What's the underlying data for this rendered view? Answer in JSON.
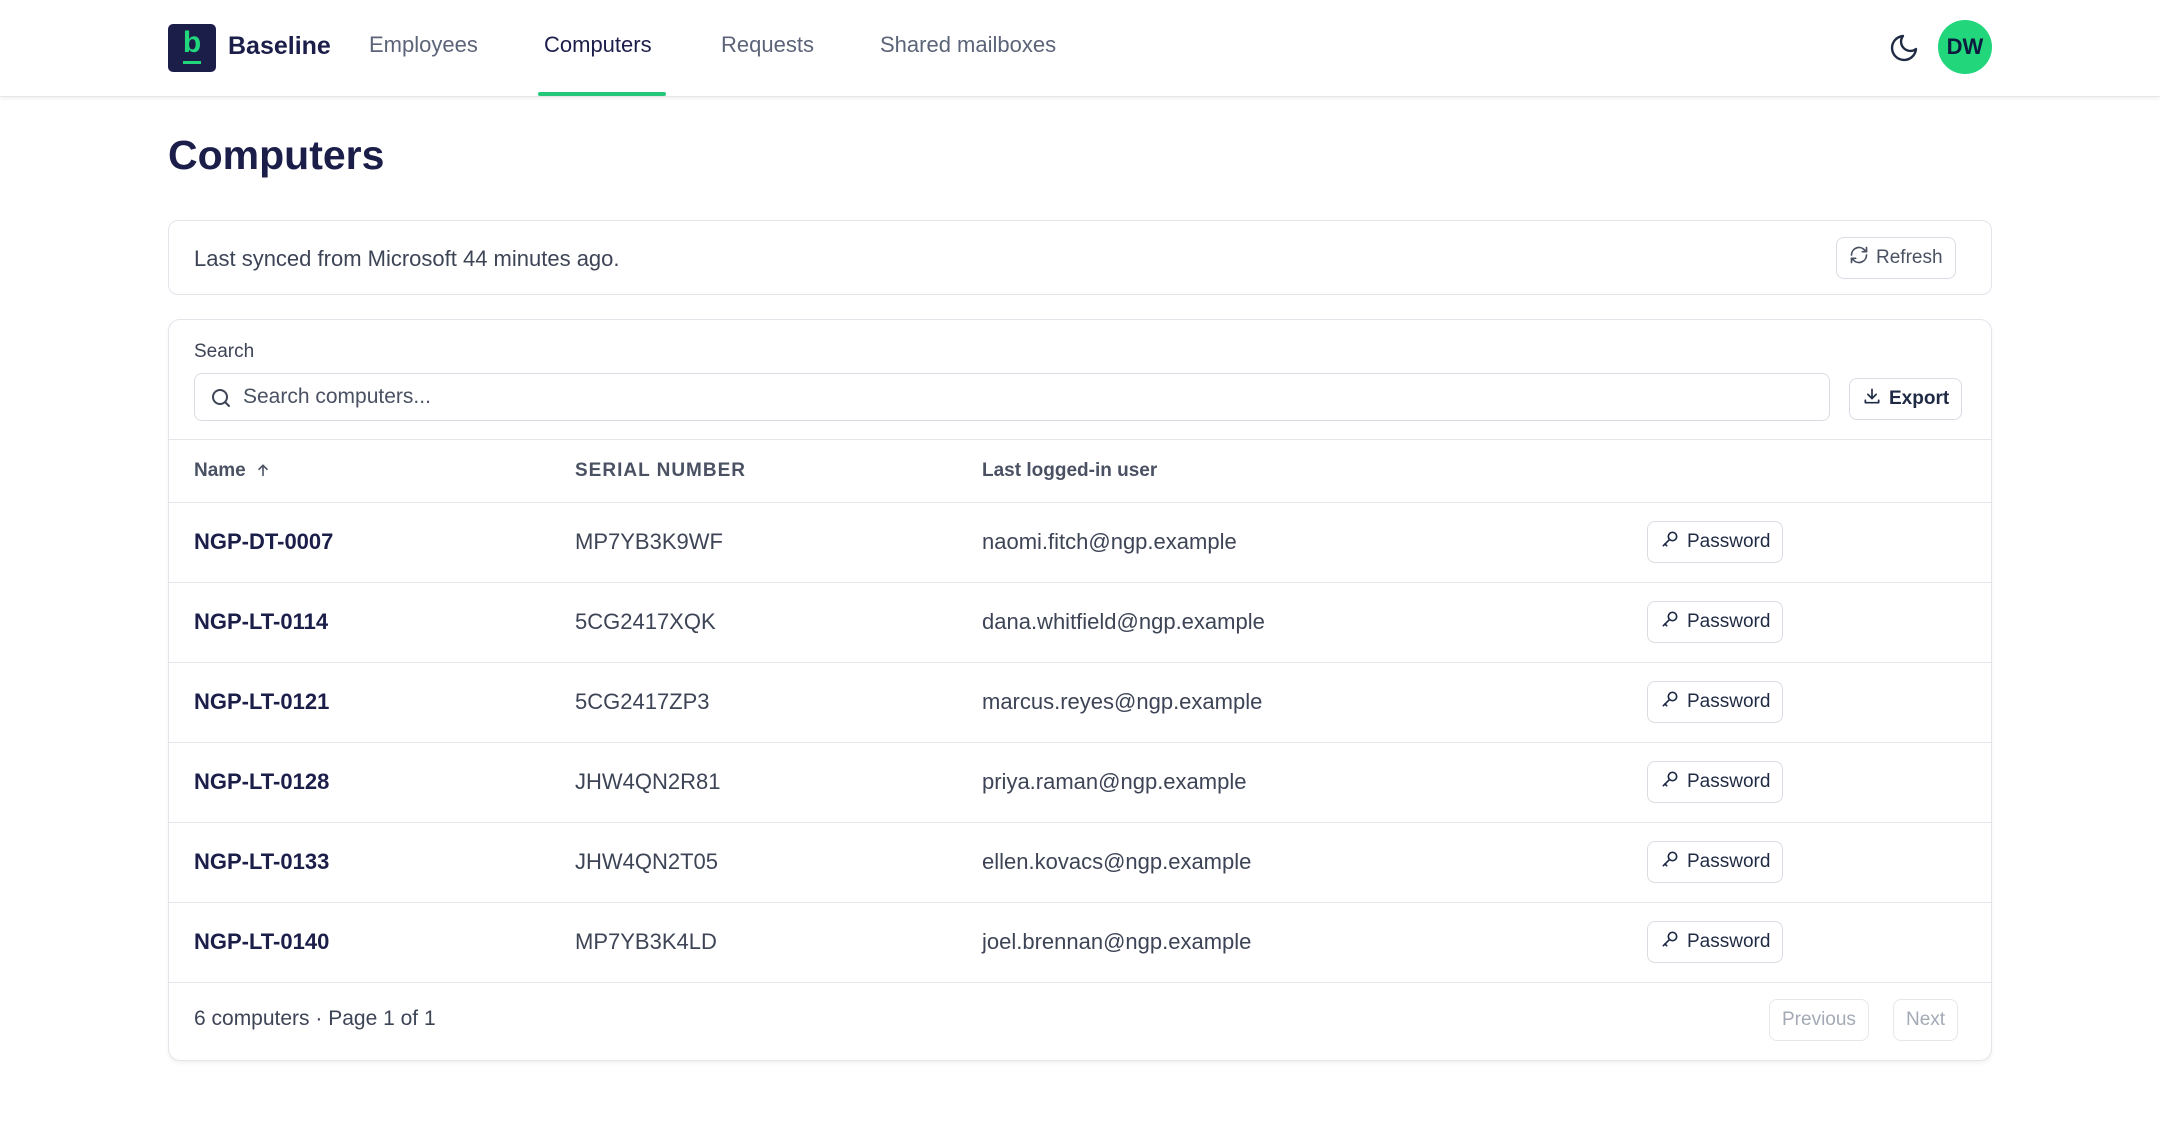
{
  "app": {
    "brand": "Baseline",
    "logo_letter": "b"
  },
  "nav": {
    "items": [
      "Employees",
      "Computers",
      "Requests",
      "Shared mailboxes"
    ],
    "active": "Computers"
  },
  "user": {
    "initials": "DW"
  },
  "page": {
    "title": "Computers"
  },
  "sync": {
    "text": "Last synced from Microsoft 44 minutes ago.",
    "refresh_label": "Refresh"
  },
  "search": {
    "label": "Search",
    "placeholder": "Search computers...",
    "value": ""
  },
  "export_label": "Export",
  "table": {
    "columns": [
      "Name",
      "SERIAL NUMBER",
      "Last logged-in user"
    ],
    "action_label": "Password",
    "rows": [
      {
        "name": "NGP-DT-0007",
        "serial": "MP7YB3K9WF",
        "user": "naomi.fitch@ngp.example"
      },
      {
        "name": "NGP-LT-0114",
        "serial": "5CG2417XQK",
        "user": "dana.whitfield@ngp.example"
      },
      {
        "name": "NGP-LT-0121",
        "serial": "5CG2417ZP3",
        "user": "marcus.reyes@ngp.example"
      },
      {
        "name": "NGP-LT-0128",
        "serial": "JHW4QN2R81",
        "user": "priya.raman@ngp.example"
      },
      {
        "name": "NGP-LT-0133",
        "serial": "JHW4QN2T05",
        "user": "ellen.kovacs@ngp.example"
      },
      {
        "name": "NGP-LT-0140",
        "serial": "MP7YB3K4LD",
        "user": "joel.brennan@ngp.example"
      }
    ]
  },
  "pagination": {
    "summary": "6 computers · Page 1 of 1",
    "previous": "Previous",
    "next": "Next"
  },
  "colors": {
    "brand_dark": "#1c1e4a",
    "accent": "#22d67c"
  }
}
